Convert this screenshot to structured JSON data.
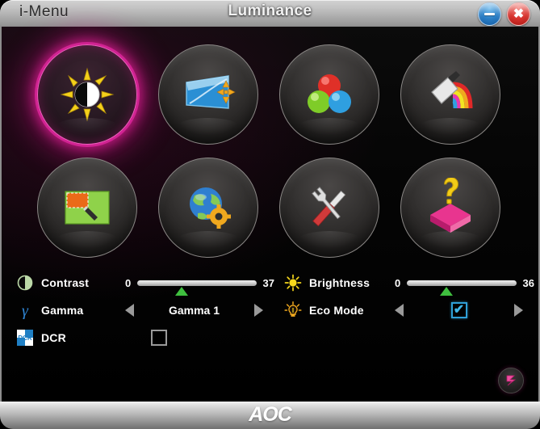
{
  "titlebar": {
    "brand": "i-Menu",
    "title": "Luminance",
    "minimize_label": "Minimize",
    "close_label": "Close"
  },
  "menu": {
    "items": [
      {
        "label": "Luminance",
        "icon": "sun-contrast-icon",
        "active": true
      },
      {
        "label": "Image Setup",
        "icon": "screen-arrows-icon",
        "active": false
      },
      {
        "label": "Color Setup",
        "icon": "rgb-spheres-icon",
        "active": false
      },
      {
        "label": "Picture Boost",
        "icon": "brush-rainbow-icon",
        "active": false
      },
      {
        "label": "OSD Setup",
        "icon": "screen-pencil-icon",
        "active": false
      },
      {
        "label": "Extra",
        "icon": "globe-gear-icon",
        "active": false
      },
      {
        "label": "Tools",
        "icon": "wrench-tools-icon",
        "active": false
      },
      {
        "label": "Help",
        "icon": "question-block-icon",
        "active": false
      }
    ]
  },
  "controls": {
    "contrast": {
      "label": "Contrast",
      "icon": "half-circle-icon",
      "min": "0",
      "max": "37",
      "value": 37,
      "range_max": 100
    },
    "gamma": {
      "label": "Gamma",
      "icon": "gamma-letter-icon",
      "value": "Gamma 1",
      "prev_label": "Previous",
      "next_label": "Next"
    },
    "dcr": {
      "label": "DCR",
      "icon": "dcr-badge-icon",
      "checked": false
    },
    "brightness": {
      "label": "Brightness",
      "icon": "sun-icon",
      "min": "0",
      "max": "36",
      "value": 36,
      "range_max": 100
    },
    "eco_mode": {
      "label": "Eco Mode",
      "icon": "lightbulb-icon",
      "checked": true,
      "check_glyph": "✔",
      "prev_label": "Previous",
      "next_label": "Next"
    }
  },
  "footer": {
    "brand": "AOC",
    "reset_label": "Reset"
  },
  "colors": {
    "accent_pink": "#e128a0",
    "slider_thumb_green": "#3fbf3f",
    "check_blue": "#3fb6e8",
    "close_red": "#d8342e",
    "minimize_blue": "#2a7fc6"
  }
}
